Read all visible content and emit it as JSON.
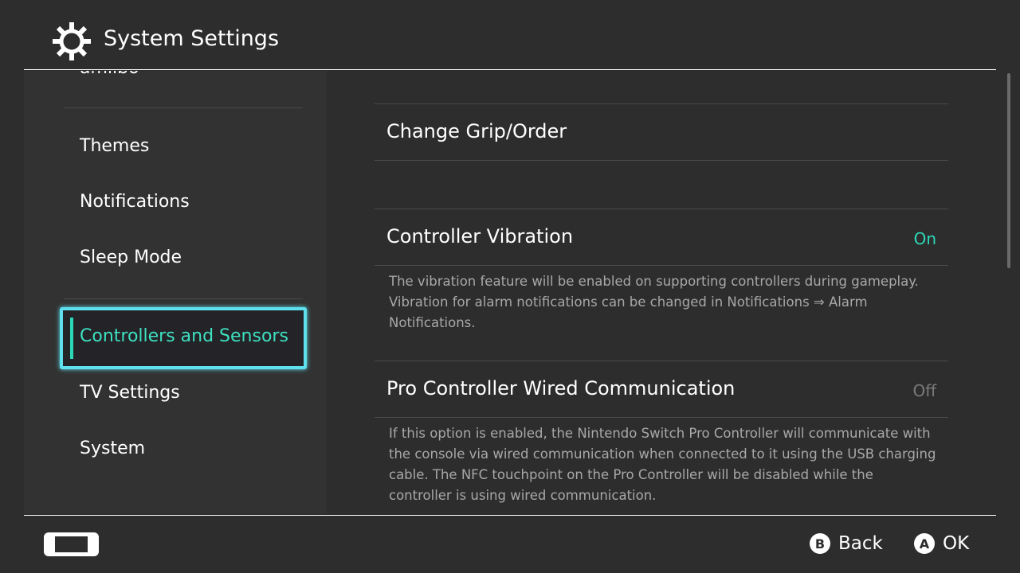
{
  "header": {
    "title": "System Settings",
    "icon": "gear-icon"
  },
  "sidebar": {
    "items": [
      {
        "label": "amiibo"
      },
      {
        "label": "Themes"
      },
      {
        "label": "Notifications"
      },
      {
        "label": "Sleep Mode"
      },
      {
        "label": "Controllers and Sensors",
        "selected": true
      },
      {
        "label": "TV Settings"
      },
      {
        "label": "System"
      }
    ]
  },
  "main": {
    "items": [
      {
        "label": "Change Grip/Order"
      },
      {
        "label": "Controller Vibration",
        "value": "On",
        "value_color": "#2bd9b8",
        "description": "The vibration feature will be enabled on supporting controllers during gameplay. Vibration for alarm notifications can be changed in Notifications ⇒ Alarm Notifications."
      },
      {
        "label": "Pro Controller Wired Communication",
        "value": "Off",
        "value_color": "#7a7a7a",
        "description": "If this option is enabled, the Nintendo Switch Pro Controller will communicate with the console via wired communication when connected to it using the USB charging cable. The NFC touchpoint on the Pro Controller will be disabled while the controller is using wired communication."
      }
    ]
  },
  "footer": {
    "back_key": "B",
    "back_label": "Back",
    "ok_key": "A",
    "ok_label": "OK",
    "console_icon": "handheld-console-icon"
  },
  "colors": {
    "accent": "#2bd9b8",
    "focus_border": "#5ee0ee"
  }
}
